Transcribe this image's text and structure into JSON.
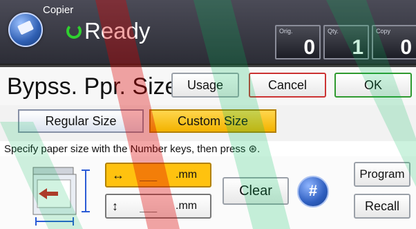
{
  "header": {
    "app_title": "Copier",
    "status": "Ready",
    "counters": [
      {
        "label": "Orig.",
        "value": "0"
      },
      {
        "label": "Qty.",
        "value": "1"
      },
      {
        "label": "Copy",
        "value": "0"
      }
    ]
  },
  "titlebar": {
    "title": "Bypss. Ppr. Size",
    "usage_label": "Usage",
    "cancel_label": "Cancel",
    "ok_label": "OK"
  },
  "tabs": {
    "regular": "Regular Size",
    "custom": "Custom Size"
  },
  "instruction": "Specify paper size with the Number keys, then press ⊛.",
  "fields": {
    "horizontal": {
      "icon": "↔",
      "value": "___",
      "unit": ".mm"
    },
    "vertical": {
      "icon": "↕",
      "value": "___",
      "unit": ".mm"
    }
  },
  "buttons": {
    "clear": "Clear",
    "hash": "#",
    "program": "Program",
    "recall": "Recall"
  },
  "colors": {
    "header_bg": "#2c2d36",
    "selected_tab": "#f3b300",
    "hash_button": "#2f5fc0",
    "ready_indicator": "#2fd02f"
  }
}
